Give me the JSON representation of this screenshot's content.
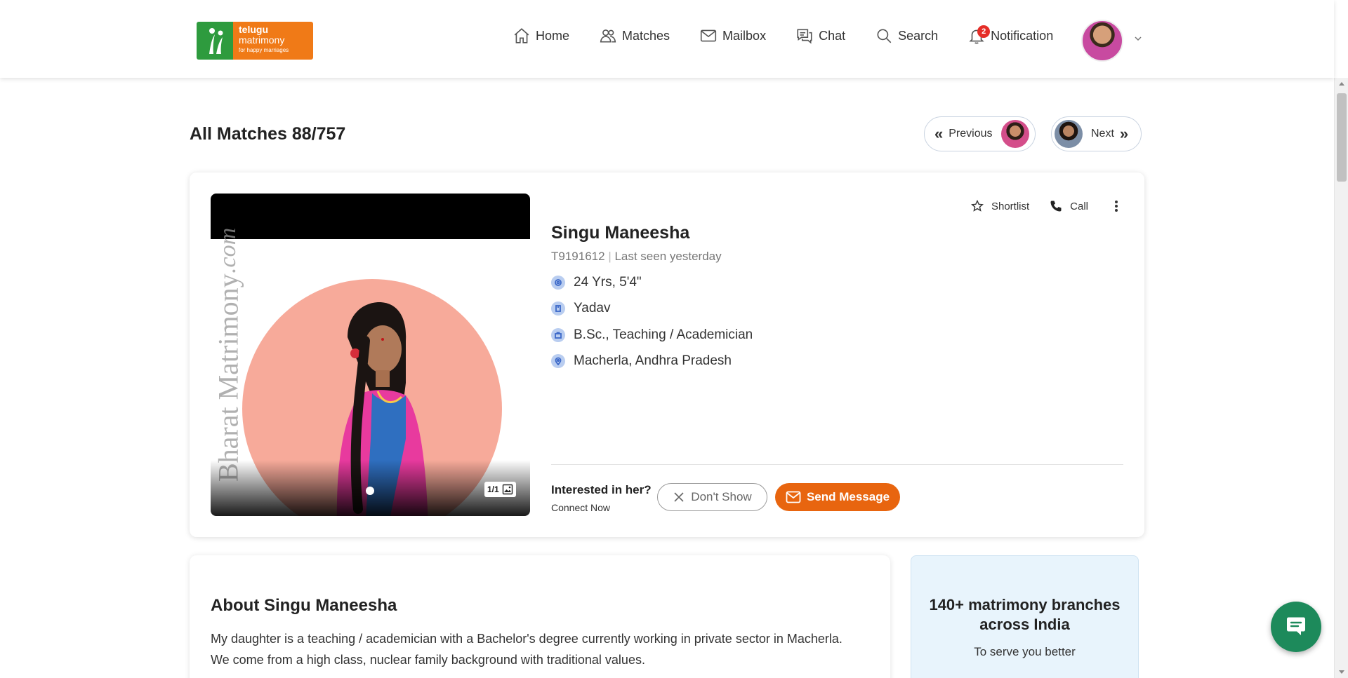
{
  "header": {
    "logo": {
      "line1": "telugu",
      "line2": "matrimony",
      "line3": "for happy marriages"
    },
    "nav": [
      {
        "label": "Home",
        "icon": "home-icon"
      },
      {
        "label": "Matches",
        "icon": "matches-icon"
      },
      {
        "label": "Mailbox",
        "icon": "mailbox-icon"
      },
      {
        "label": "Chat",
        "icon": "chat-icon"
      },
      {
        "label": "Search",
        "icon": "search-icon"
      },
      {
        "label": "Notification",
        "icon": "bell-icon",
        "badge": "2"
      }
    ]
  },
  "page": {
    "title": "All Matches 88/757",
    "previous_label": "Previous",
    "next_label": "Next"
  },
  "profile": {
    "name": "Singu Maneesha",
    "id": "T9191612",
    "last_seen": "Last seen yesterday",
    "age_height": "24 Yrs, 5'4\"",
    "caste": "Yadav",
    "education_profession": "B.Sc., Teaching / Academician",
    "location": "Macherla, Andhra Pradesh",
    "photo_count": "1/1",
    "watermark": "Bharat Matrimony",
    "watermark_suffix": ".com",
    "shortlist_label": "Shortlist",
    "call_label": "Call",
    "interest_question": "Interested in her?",
    "interest_sub": "Connect Now",
    "dont_show_label": "Don't Show",
    "send_message_label": "Send Message"
  },
  "about": {
    "title": "About Singu Maneesha",
    "text": "My daughter is a teaching / academician with a Bachelor's degree currently working in private sector in Macherla. We come from a high class, nuclear family background with traditional values."
  },
  "promo": {
    "title": "140+ matrimony branches across India",
    "subtitle": "To serve you better"
  },
  "colors": {
    "accent": "#e8650f",
    "logo_green": "#2e9b3e",
    "logo_orange": "#f07a17",
    "badge_red": "#e52d27",
    "chat_fab": "#1d8a5b"
  }
}
